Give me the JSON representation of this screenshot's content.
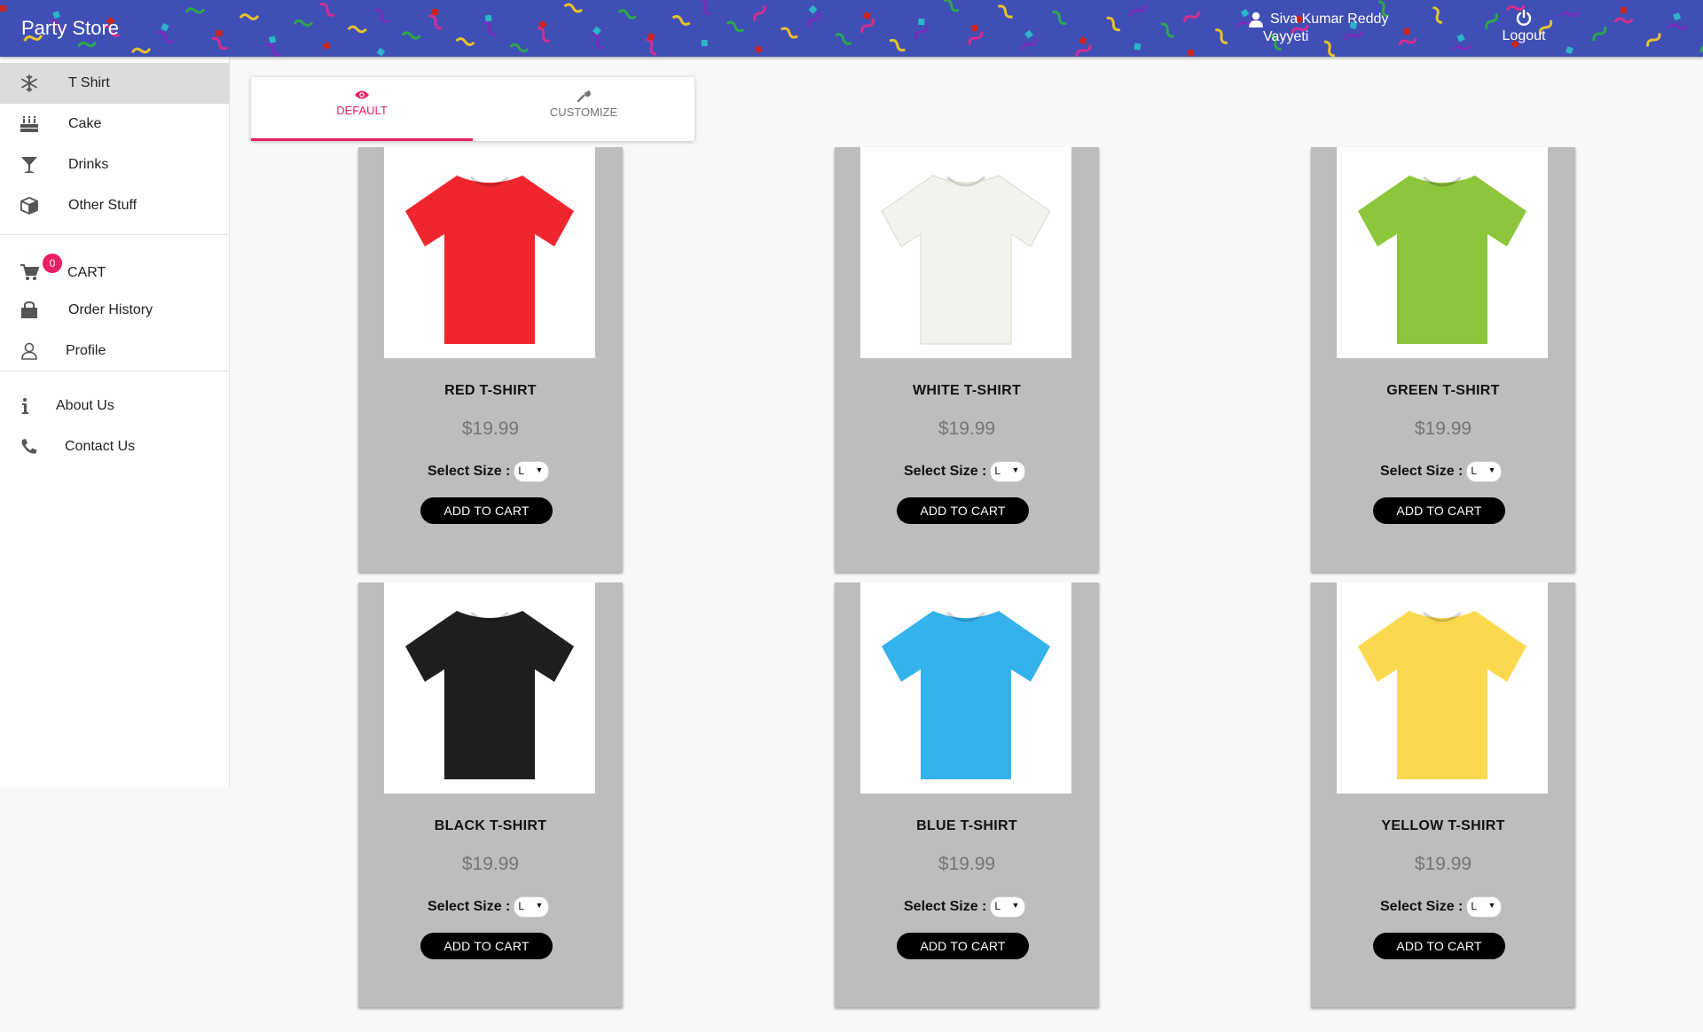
{
  "header": {
    "brand": "Party Store",
    "user_name_line1": "Siva Kumar Reddy",
    "user_name_line2": "Vayyeti",
    "logout_label": "Logout",
    "background_color": "#3f4fb5"
  },
  "sidebar": {
    "items": [
      {
        "label": "T Shirt",
        "icon": "snowflake-icon",
        "active": true
      },
      {
        "label": "Cake",
        "icon": "cake-icon"
      },
      {
        "label": "Drinks",
        "icon": "cocktail-glass-icon"
      },
      {
        "label": "Other Stuff",
        "icon": "box-icon"
      },
      {
        "label": "CART",
        "icon": "cart-icon",
        "badge": "0"
      },
      {
        "label": "Order History",
        "icon": "shopping-bag-icon"
      },
      {
        "label": "Profile",
        "icon": "person-outline-icon"
      },
      {
        "label": "About Us",
        "icon": "info-icon"
      },
      {
        "label": "Contact Us",
        "icon": "phone-icon"
      }
    ]
  },
  "tabs": [
    {
      "label": "DEFAULT",
      "icon": "eye-icon",
      "active": true
    },
    {
      "label": "CUSTOMIZE",
      "icon": "wrench-icon",
      "active": false
    }
  ],
  "accent_color": "#e91e63",
  "products": [
    {
      "title": "RED T-SHIRT",
      "price": "$19.99",
      "size_label": "Select Size :",
      "size": "L",
      "button": "ADD TO CART",
      "shirt_color": "#f0262f"
    },
    {
      "title": "WHITE T-SHIRT",
      "price": "$19.99",
      "size_label": "Select Size :",
      "size": "L",
      "button": "ADD TO CART",
      "shirt_color": "#f3f3ee"
    },
    {
      "title": "GREEN T-SHIRT",
      "price": "$19.99",
      "size_label": "Select Size :",
      "size": "L",
      "button": "ADD TO CART",
      "shirt_color": "#8cc63a"
    },
    {
      "title": "BLACK T-SHIRT",
      "price": "$19.99",
      "size_label": "Select Size :",
      "size": "L",
      "button": "ADD TO CART",
      "shirt_color": "#1e1e1e"
    },
    {
      "title": "BLUE T-SHIRT",
      "price": "$19.99",
      "size_label": "Select Size :",
      "size": "L",
      "button": "ADD TO CART",
      "shirt_color": "#34b2ec"
    },
    {
      "title": "YELLOW T-SHIRT",
      "price": "$19.99",
      "size_label": "Select Size :",
      "size": "L",
      "button": "ADD TO CART",
      "shirt_color": "#fbd94f"
    }
  ]
}
